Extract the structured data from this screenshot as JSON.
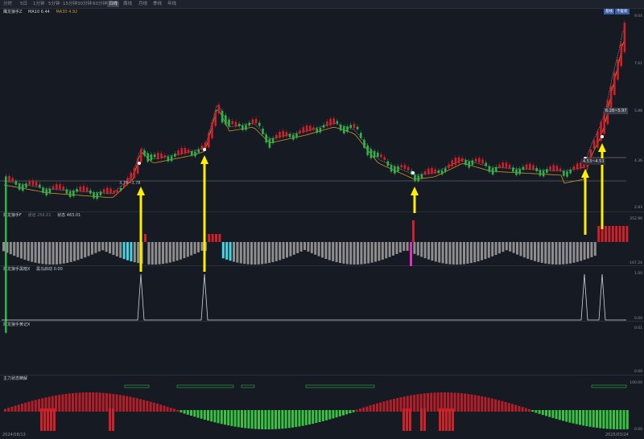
{
  "topbar": {
    "tabs": [
      "分时",
      "5日",
      "1分钟",
      "5分钟",
      "15分钟",
      "30分钟",
      "60分钟",
      "日线",
      "周线",
      "月线",
      "季线",
      "年线"
    ],
    "active_tab": "日线"
  },
  "main_panel": {
    "name": "鹰龙狼手Z",
    "ma10_label": "MA10 6.44",
    "ma30_label": "MA30 4.92",
    "ytick_top": "9.04",
    "ytick_1": "7.61",
    "ytick_2": "5.88",
    "ytick_3": "4.36",
    "ytick_4": "2.83",
    "price_ann_1": "3.78~3.78",
    "price_ann_2": "6.28~5.97",
    "price_ann_3": "4.53~4.53",
    "btn_1": "基线",
    "btn_2": "不复权"
  },
  "panel2": {
    "name": "鹰龙狼手F",
    "label_a": "通道 256.01",
    "label_b": "状态 463.01",
    "ytick_top": "252.96",
    "ytick_bottom": "-167.24"
  },
  "panel3": {
    "name": "鹰龙狼手黑暗X",
    "label_a": "黑马启动 0.00",
    "ytick_top": "1.00",
    "ytick_bottom": "0.00"
  },
  "panel4": {
    "name": "鹰龙狼手黄记X",
    "ytick_top": "0.01",
    "ytick_bottom": "0.00"
  },
  "panel5": {
    "name": "主力状态精解",
    "ytick_top": "100.00",
    "ytick_bottom": "0.00",
    "tag": "主力进"
  },
  "dates": {
    "left": "2024/08/13",
    "right": "2025/03/24"
  },
  "colors": {
    "up": "#d0202a",
    "down": "#2fb24a",
    "ma10": "#9aa0b8",
    "ma30": "#c8952a",
    "arrow": "#ffee00"
  }
}
